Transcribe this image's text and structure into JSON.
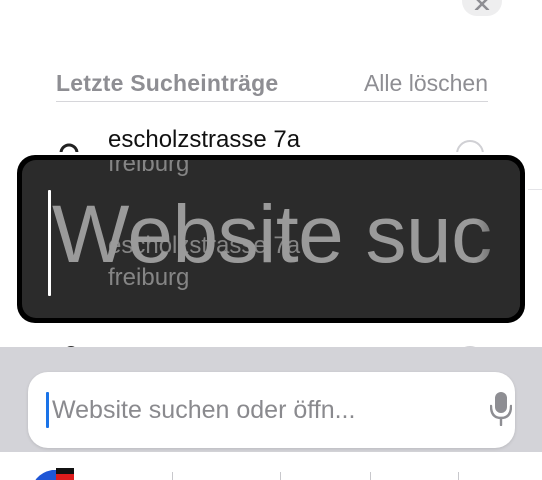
{
  "recents": {
    "title": "Letzte Sucheinträge",
    "clear_all": "Alle löschen",
    "items": [
      {
        "line1": "escholzstrasse 7a",
        "line2": "freiburg"
      },
      {
        "line1": "escholzstrasse 7a",
        "line2": "freiburg"
      }
    ]
  },
  "search": {
    "placeholder": "Website suchen oder öffn...",
    "value": ""
  },
  "magnifier": {
    "text": "Website suc"
  },
  "colors": {
    "accent": "#1a73e8",
    "secondary_text": "#8e8e93",
    "tray_background": "#d3d3d8"
  },
  "icons": {
    "close": "close-icon",
    "search": "search-icon",
    "remove": "remove-icon",
    "microphone": "microphone-icon",
    "globe": "globe-flag-icon"
  }
}
